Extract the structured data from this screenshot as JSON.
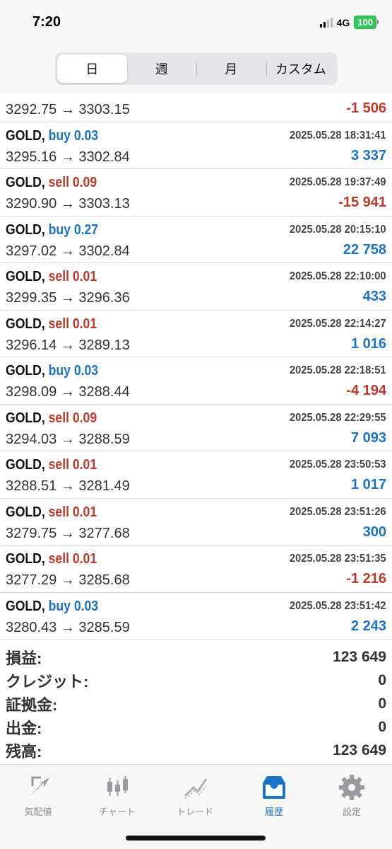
{
  "status_bar": {
    "time": "7:20",
    "network": "4G",
    "battery": "100"
  },
  "period_tabs": [
    {
      "label": "日",
      "active": true
    },
    {
      "label": "週",
      "active": false
    },
    {
      "label": "月",
      "active": false
    },
    {
      "label": "カスタム",
      "active": false
    }
  ],
  "partial_row": {
    "prices": "3292.75 → 3303.15",
    "profit": "-1 506"
  },
  "trades": [
    {
      "symbol": "GOLD,",
      "side": "buy 0.03",
      "time": "2025.05.28 18:31:41",
      "prices": "3295.16 → 3302.84",
      "profit": "3 337"
    },
    {
      "symbol": "GOLD,",
      "side": "sell 0.09",
      "time": "2025.05.28 19:37:49",
      "prices": "3290.90 → 3303.13",
      "profit": "-15 941"
    },
    {
      "symbol": "GOLD,",
      "side": "buy 0.27",
      "time": "2025.05.28 20:15:10",
      "prices": "3297.02 → 3302.84",
      "profit": "22 758"
    },
    {
      "symbol": "GOLD,",
      "side": "sell 0.01",
      "time": "2025.05.28 22:10:00",
      "prices": "3299.35 → 3296.36",
      "profit": "433"
    },
    {
      "symbol": "GOLD,",
      "side": "sell 0.01",
      "time": "2025.05.28 22:14:27",
      "prices": "3296.14 → 3289.13",
      "profit": "1 016"
    },
    {
      "symbol": "GOLD,",
      "side": "buy 0.03",
      "time": "2025.05.28 22:18:51",
      "prices": "3298.09 → 3288.44",
      "profit": "-4 194"
    },
    {
      "symbol": "GOLD,",
      "side": "sell 0.09",
      "time": "2025.05.28 22:29:55",
      "prices": "3294.03 → 3288.59",
      "profit": "7 093"
    },
    {
      "symbol": "GOLD,",
      "side": "sell 0.01",
      "time": "2025.05.28 23:50:53",
      "prices": "3288.51 → 3281.49",
      "profit": "1 017"
    },
    {
      "symbol": "GOLD,",
      "side": "sell 0.01",
      "time": "2025.05.28 23:51:26",
      "prices": "3279.75 → 3277.68",
      "profit": "300"
    },
    {
      "symbol": "GOLD,",
      "side": "sell 0.01",
      "time": "2025.05.28 23:51:35",
      "prices": "3277.29 → 3285.68",
      "profit": "-1 216"
    },
    {
      "symbol": "GOLD,",
      "side": "buy 0.03",
      "time": "2025.05.28 23:51:42",
      "prices": "3280.43 → 3285.59",
      "profit": "2 243"
    }
  ],
  "summary": [
    {
      "label": "損益:",
      "value": "123 649"
    },
    {
      "label": "クレジット:",
      "value": "0"
    },
    {
      "label": "証拠金:",
      "value": "0"
    },
    {
      "label": "出金:",
      "value": "0"
    },
    {
      "label": "残高:",
      "value": "123 649"
    }
  ],
  "tabbar": [
    {
      "label": "気配値",
      "icon": "quotes-arrows-icon",
      "active": false
    },
    {
      "label": "チャート",
      "icon": "candlestick-chart-icon",
      "active": false
    },
    {
      "label": "トレード",
      "icon": "trade-line-icon",
      "active": false
    },
    {
      "label": "履歴",
      "icon": "history-tray-icon",
      "active": true
    },
    {
      "label": "設定",
      "icon": "gear-icon",
      "active": false
    }
  ],
  "colors": {
    "buy": "#1a73c8",
    "sell": "#c0392b",
    "active_tab": "#1a73c8",
    "inactive_tab": "#8e8e93"
  }
}
